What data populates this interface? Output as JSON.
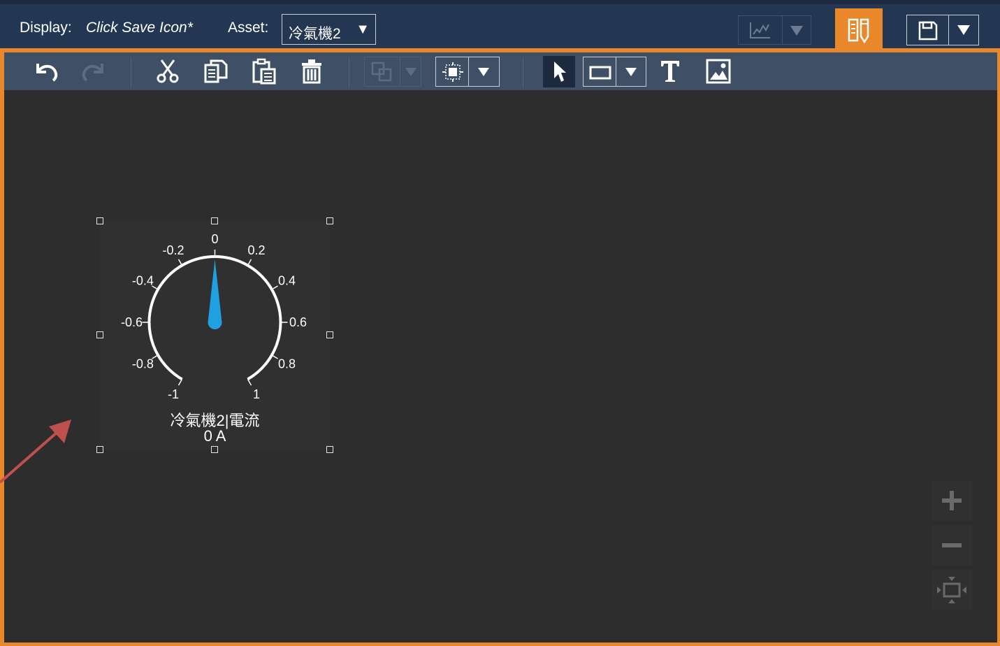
{
  "header": {
    "display_label": "Display:",
    "display_name": "Click Save Icon*",
    "asset_label": "Asset:",
    "asset_value": "冷氣機2",
    "asset_arrow": "▼"
  },
  "toolbar": {
    "icons": [
      "undo-icon",
      "redo-icon",
      "cut-icon",
      "copy-icon",
      "paste-icon",
      "delete-icon",
      "arrange-icon",
      "align-icon",
      "pointer-icon",
      "rectangle-icon",
      "text-icon",
      "image-icon"
    ]
  },
  "gauge": {
    "ticks": [
      "-1",
      "-0.8",
      "-0.6",
      "-0.4",
      "-0.2",
      "0",
      "0.2",
      "0.4",
      "0.6",
      "0.8",
      "1"
    ],
    "title": "冷氣機2|電流",
    "value_text": "0 A",
    "value": 0,
    "min": -1,
    "max": 1,
    "needle_color": "#1fa0e0"
  },
  "colors": {
    "accent": "#e8882a",
    "header_bg": "#243752",
    "toolbar_bg": "#3e4f66",
    "canvas_bg": "#2d2d2d"
  },
  "zoom": {
    "icons": [
      "zoom-in-icon",
      "zoom-out-icon",
      "fit-to-screen-icon"
    ]
  }
}
